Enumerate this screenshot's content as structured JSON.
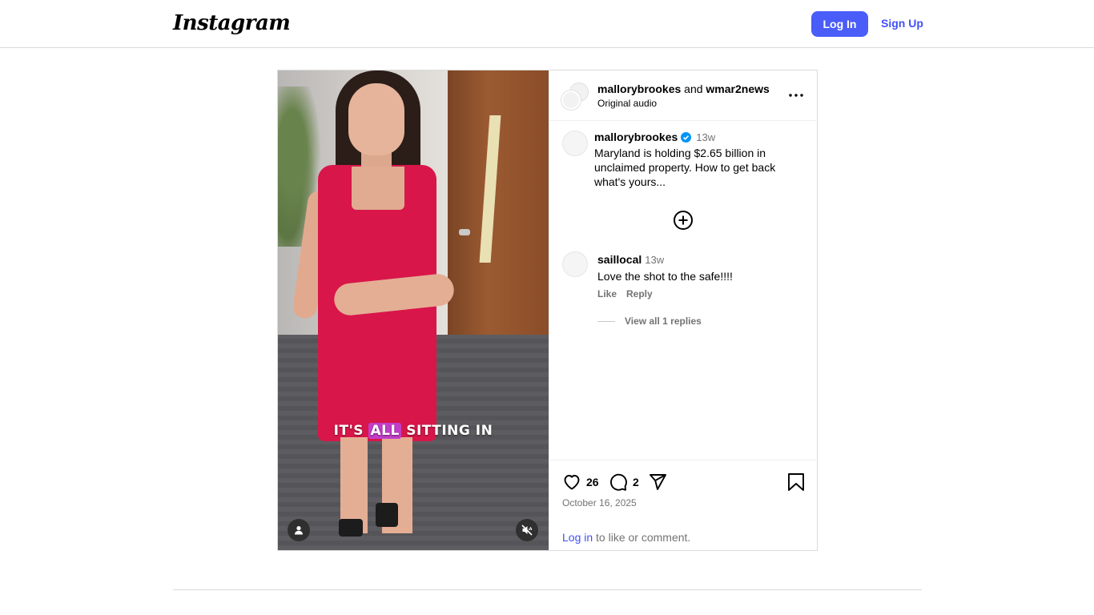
{
  "topbar": {
    "logo": "Instagram",
    "login_label": "Log In",
    "signup_label": "Sign Up"
  },
  "post": {
    "header": {
      "user1": "mallorybrookes",
      "joiner": "and",
      "user2": "wmar2news",
      "audio": "Original audio"
    },
    "caption": {
      "username": "mallorybrookes",
      "time": "13w",
      "text": "Maryland is holding $2.65 billion in unclaimed property. How to get back what's yours..."
    },
    "comments": [
      {
        "username": "saillocal",
        "time": "13w",
        "text": "Love the shot to the safe!!!!",
        "like_label": "Like",
        "reply_label": "Reply",
        "view_replies": "View all 1 replies"
      }
    ],
    "likes_count": "26",
    "comments_count": "2",
    "date": "October 16, 2025",
    "login_prompt_link": "Log in",
    "login_prompt_rest": " to like or comment.",
    "video": {
      "subtitle_before": "IT'S ",
      "subtitle_highlight": "ALL",
      "subtitle_after": " SITTING IN"
    }
  },
  "colors": {
    "accent": "#4a5df9",
    "link": "#4150f7",
    "verified": "#0095f6",
    "highlight": "#c23ec8"
  }
}
